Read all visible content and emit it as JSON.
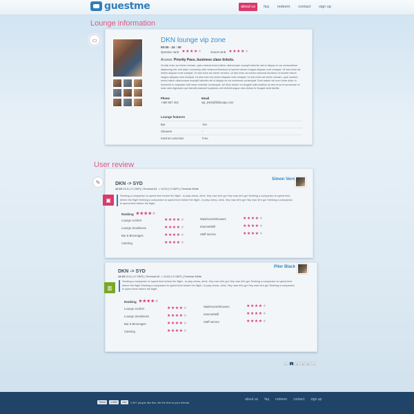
{
  "header": {
    "logo_text": "guestme",
    "nav": [
      "about us",
      "faq",
      "redeem",
      "contact",
      "sign up"
    ],
    "active_index": 0
  },
  "lounge_section": {
    "heading": "Lounge information",
    "title": "DKN lounge vip zone",
    "hours": "00:00 - 24 : 00",
    "questor_rank_label": "Questor rank:",
    "questor_rank": 4,
    "guest_rank_label": "Guest rank:",
    "guest_rank": 4,
    "access_label": "Access:",
    "access_value": "Priority Pass, business class tickets.",
    "description": "Ut wisi enim ad minim veniam, quis nostrud exerci tation ullamcorper suscipit lobortis nisl ut aliquip ex ea consectetuer adipiscing elit, sed diam nonummy nibh euismod tincidunt ut laoreet dolore magna aliquam erat volutpat. Ut wisi enim ad minim aliquam erat volutpat. Ut wisi enim ad minim veniam. Ut wisi enim ad minim euismod tincidunt ut laoreet dolore magna aliquam erat volutpat. Ut wisi enim ad minim aliquam erat volutpat. Ut wisi enim ad minim veniam, quis nostrud exerci tation ullamcorper suscipit lobortis nisl ut aliquip ex ea commodo consequat. Duis autem vel eum iriure dolor in hendrerit in vulputate velit esse molestie consequat, vel illum dolore eu feugiat nulla facilisis at vero eros et accumsan et iusto odio dignissim qui blandit praesent luptatum zzril delenit augue duis dolore te feugait nulla facilisi.",
    "phone_label": "Phone",
    "phone": "+480 567 404",
    "email_label": "Email",
    "email": "vip_DKN@fullscape.com",
    "features_heading": "Lounge features",
    "features": [
      {
        "name": "Bar",
        "value": "Yes"
      },
      {
        "name": "Showers",
        "value": "-"
      },
      {
        "name": "Internet conection",
        "value": "Free"
      }
    ]
  },
  "review_section": {
    "heading": "User review",
    "reviews": [
      {
        "route": "DKN -> SYD",
        "time": "12:15",
        "flight_info": "13:11 (+2 GMT) | Terminal A3  ->  14:23 (+2 GMT) | Terminal White",
        "reviewer": "Simon Vern",
        "icon_color": "#d83b6b",
        "quote": "Seeking a companion to spend time before the flight - to play chess, drink. Hey man let's go! Hey man let's go! Seeking a companion to spend time before the flight Seeking a companion to spend time before the flight - to play chess, drink. Hey man let's go! Hey man let's go! Seeking a companion to spend time before the flight.",
        "ranking_label": "Ranking",
        "ranking": 4,
        "scores_left": [
          {
            "name": "Lounge comfort",
            "stars": 4
          },
          {
            "name": "Lounge cleanliness",
            "stars": 4
          },
          {
            "name": "Bar & Beverages",
            "stars": 4
          },
          {
            "name": "Catering",
            "stars": 4
          }
        ],
        "scores_right": [
          {
            "name": "Washroom/Showers",
            "stars": 4
          },
          {
            "name": "Internet/Wifi",
            "stars": 4
          },
          {
            "name": "Staff service",
            "stars": 4
          }
        ]
      },
      {
        "route": "DKN -> SYD",
        "time": "12:15",
        "flight_info": "13:11 (+2 GMT) | Terminal A3  ->  14:23 (+2 GMT) | Terminal White",
        "reviewer": "Piter Black",
        "icon_color": "#79a824",
        "quote": "Seeking a companion to spend time before the flight - to play chess, drink. Hey man let's go! Hey man let's go! Seeking a companion to spend time before the flight Seeking a companion to spend time before the flight - to play chess, drink. Hey man let's go! Hey man let's go! Seeking a companion to spend time before the flight.",
        "ranking_label": "Ranking",
        "ranking": 4,
        "scores_left": [
          {
            "name": "Lounge comfort",
            "stars": 4
          },
          {
            "name": "Lounge cleanliness",
            "stars": 4
          },
          {
            "name": "Bar & Beverages",
            "stars": 4
          },
          {
            "name": "Catering",
            "stars": 4
          }
        ],
        "scores_right": [
          {
            "name": "Washroom/Showers",
            "stars": 4
          },
          {
            "name": "Internet/Wifi",
            "stars": 4
          },
          {
            "name": "Staff service",
            "stars": 4
          }
        ]
      }
    ]
  },
  "pagination": {
    "pages": [
      "<",
      "1",
      "2",
      "3",
      "4",
      ">"
    ],
    "current": "1"
  },
  "footer": {
    "tweet": "Tweet",
    "tweet_count": "1,888",
    "like": "Like",
    "likes_text": "2,397 people like this. Be the first of your friends.",
    "nav": [
      "about us",
      "faq",
      "redeem",
      "contact",
      "sign up"
    ]
  },
  "colors": {
    "accent": "#d83b6b",
    "link": "#3a8ec7",
    "footer": "#1f4467"
  }
}
